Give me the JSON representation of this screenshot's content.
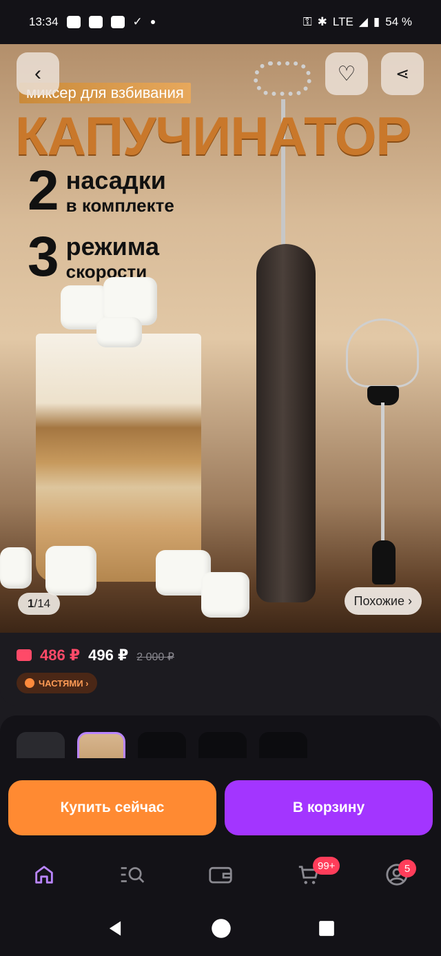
{
  "status_bar": {
    "time": "13:34",
    "network": "LTE",
    "battery": "54 %"
  },
  "product_image": {
    "subtitle": "миксер для взбивания",
    "title": "КАПУЧИНАТОР",
    "feature1": {
      "num": "2",
      "line1": "насадки",
      "line2": "в комплекте"
    },
    "feature2": {
      "num": "3",
      "line1": "режима",
      "line2": "скорости"
    },
    "page_current": "1",
    "page_total": "/14",
    "similar_label": "Похожие ›"
  },
  "price": {
    "wallet_price": "486 ₽",
    "current_price": "496 ₽",
    "old_price": "2 000 ₽",
    "installment_label": "ЧАСТЯМИ ›"
  },
  "actions": {
    "buy_now": "Купить сейчас",
    "add_to_cart": "В корзину"
  },
  "bottom_nav": {
    "items": [
      {
        "icon": "home-icon",
        "active": true
      },
      {
        "icon": "catalog-search-icon"
      },
      {
        "icon": "wallet-icon"
      },
      {
        "icon": "cart-icon",
        "badge": "99+"
      },
      {
        "icon": "profile-icon",
        "badge": "5"
      }
    ]
  },
  "colors": {
    "accent_purple": "#a335ff",
    "accent_orange": "#ff8a32",
    "price_red": "#ff4a68",
    "background": "#1c1b20"
  }
}
